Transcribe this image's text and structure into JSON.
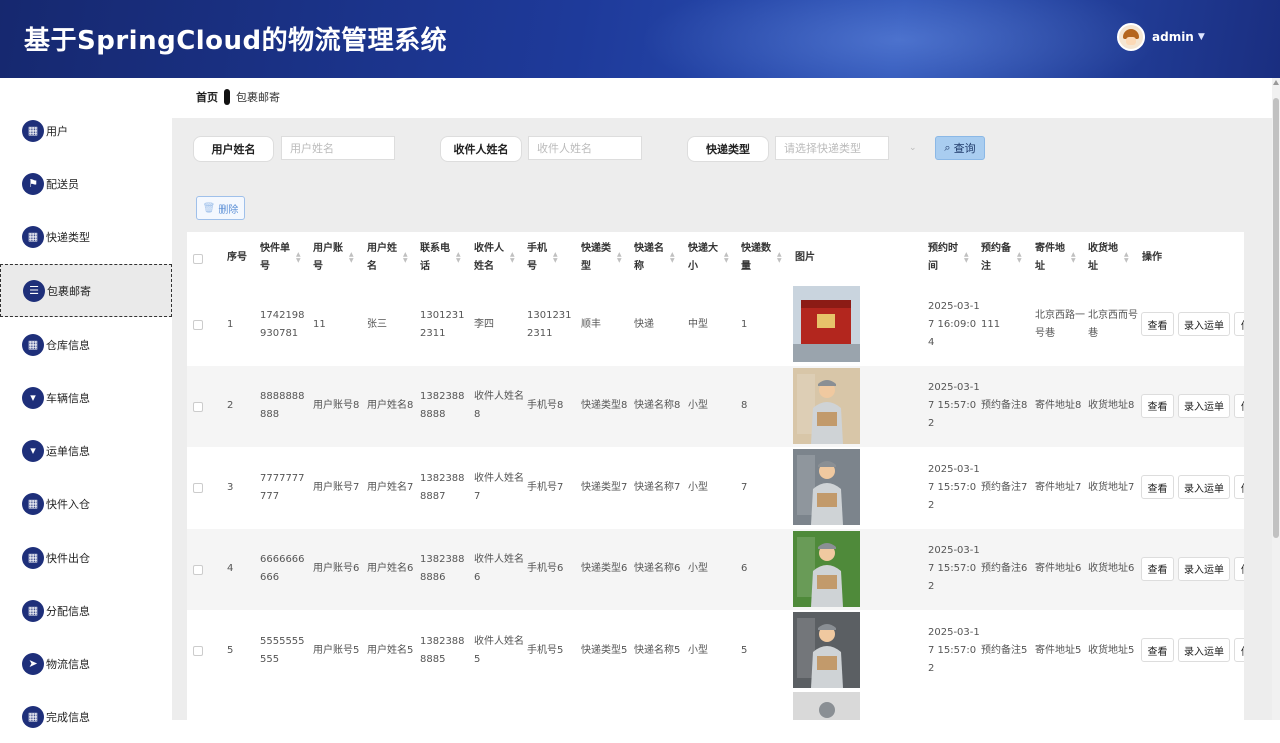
{
  "header": {
    "title": "基于SpringCloud的物流管理系统",
    "username": "admin"
  },
  "sidebar": {
    "items": [
      {
        "label": "用户",
        "icon": "grid-icon"
      },
      {
        "label": "配送员",
        "icon": "flag-icon"
      },
      {
        "label": "快递类型",
        "icon": "grid-icon"
      },
      {
        "label": "包裹邮寄",
        "icon": "list-icon",
        "active": true
      },
      {
        "label": "仓库信息",
        "icon": "grid-icon"
      },
      {
        "label": "车辆信息",
        "icon": "tag-icon"
      },
      {
        "label": "运单信息",
        "icon": "tag-icon"
      },
      {
        "label": "快件入仓",
        "icon": "grid-icon"
      },
      {
        "label": "快件出仓",
        "icon": "grid-icon"
      },
      {
        "label": "分配信息",
        "icon": "grid-icon"
      },
      {
        "label": "物流信息",
        "icon": "send-icon"
      },
      {
        "label": "完成信息",
        "icon": "grid-icon"
      }
    ]
  },
  "breadcrumb": {
    "home": "首页",
    "current": "包裹邮寄"
  },
  "search": {
    "user_name_label": "用户姓名",
    "user_name_placeholder": "用户姓名",
    "receiver_label": "收件人姓名",
    "receiver_placeholder": "收件人姓名",
    "type_label": "快递类型",
    "type_placeholder": "请选择快递类型",
    "query_label": "查询"
  },
  "toolbar": {
    "delete_label": "删除"
  },
  "table": {
    "headers": {
      "index": "序号",
      "no": "快件单号",
      "account": "用户账号",
      "name": "用户姓名",
      "phone": "联系电话",
      "receiver": "收件人姓名",
      "mobile": "手机号",
      "type": "快递类型",
      "ename": "快递名称",
      "size": "快递大小",
      "qty": "快递数量",
      "image": "图片",
      "time": "预约时间",
      "remark": "预约备注",
      "from": "寄件地址",
      "to": "收货地址",
      "ops": "操作"
    },
    "actions": {
      "view": "查看",
      "enter": "录入运单",
      "more": "修"
    },
    "rows": [
      {
        "index": "1",
        "no": "1742198930781",
        "account": "11",
        "name": "张三",
        "phone": "13012312311",
        "receiver": "李四",
        "mobile": "13012312311",
        "type": "顺丰",
        "ename": "快递",
        "size": "中型",
        "qty": "1",
        "time": "2025-03-17 16:09:04",
        "remark": "111",
        "from": "北京西路一号巷",
        "to": "北京西而号巷",
        "img": "box"
      },
      {
        "index": "2",
        "no": "8888888888",
        "account": "用户账号8",
        "name": "用户姓名8",
        "phone": "13823888888",
        "receiver": "收件人姓名8",
        "mobile": "手机号8",
        "type": "快递类型8",
        "ename": "快递名称8",
        "size": "小型",
        "qty": "8",
        "time": "2025-03-17 15:57:02",
        "remark": "预约备注8",
        "from": "寄件地址8",
        "to": "收货地址8",
        "img": "person"
      },
      {
        "index": "3",
        "no": "7777777777",
        "account": "用户账号7",
        "name": "用户姓名7",
        "phone": "13823888887",
        "receiver": "收件人姓名7",
        "mobile": "手机号7",
        "type": "快递类型7",
        "ename": "快递名称7",
        "size": "小型",
        "qty": "7",
        "time": "2025-03-17 15:57:02",
        "remark": "预约备注7",
        "from": "寄件地址7",
        "to": "收货地址7",
        "img": "person"
      },
      {
        "index": "4",
        "no": "6666666666",
        "account": "用户账号6",
        "name": "用户姓名6",
        "phone": "13823888886",
        "receiver": "收件人姓名6",
        "mobile": "手机号6",
        "type": "快递类型6",
        "ename": "快递名称6",
        "size": "小型",
        "qty": "6",
        "time": "2025-03-17 15:57:02",
        "remark": "预约备注6",
        "from": "寄件地址6",
        "to": "收货地址6",
        "img": "person"
      },
      {
        "index": "5",
        "no": "5555555555",
        "account": "用户账号5",
        "name": "用户姓名5",
        "phone": "13823888885",
        "receiver": "收件人姓名5",
        "mobile": "手机号5",
        "type": "快递类型5",
        "ename": "快递名称5",
        "size": "小型",
        "qty": "5",
        "time": "2025-03-17 15:57:02",
        "remark": "预约备注5",
        "from": "寄件地址5",
        "to": "收货地址5",
        "img": "person"
      }
    ]
  },
  "colors": {
    "header": "#1e3a9a",
    "sidebar_icon": "#1e2f7a",
    "query_button": "#a9cdf0",
    "main_bg": "#ededed"
  }
}
